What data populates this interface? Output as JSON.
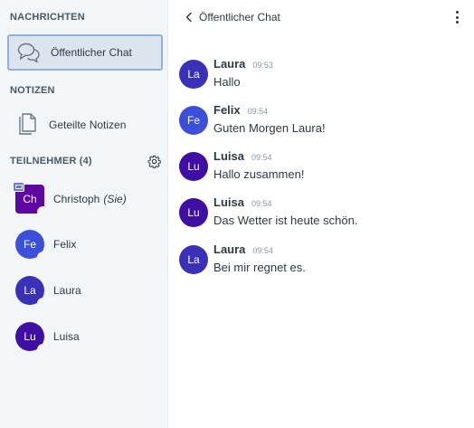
{
  "sidebar": {
    "messages_section": "NACHRICHTEN",
    "public_chat_label": "Öffentlicher Chat",
    "notes_section": "NOTIZEN",
    "shared_notes_label": "Geteilte Notizen",
    "participants_section": "TEILNEHMER (4)",
    "participants": [
      {
        "initials": "Ch",
        "name": "Christoph",
        "tag": "(Sie)",
        "color": "#5e05a2",
        "presenter": true
      },
      {
        "initials": "Fe",
        "name": "Felix",
        "color": "#3b4fd9"
      },
      {
        "initials": "La",
        "name": "Laura",
        "color": "#3a31b8"
      },
      {
        "initials": "Lu",
        "name": "Luisa",
        "color": "#3f0ea3"
      }
    ]
  },
  "chat": {
    "title": "Öffentlicher Chat",
    "messages": [
      {
        "initials": "La",
        "sender": "Laura",
        "time": "09:53",
        "text": "Hallo",
        "color": "#3a31b8"
      },
      {
        "initials": "Fe",
        "sender": "Felix",
        "time": "09:54",
        "text": "Guten Morgen Laura!",
        "color": "#3b4fd9"
      },
      {
        "initials": "Lu",
        "sender": "Luisa",
        "time": "09:54",
        "text": "Hallo zusammen!",
        "color": "#3f0ea3"
      },
      {
        "initials": "Lu",
        "sender": "Luisa",
        "time": "09:54",
        "text": "Das Wetter ist heute schön.",
        "color": "#3f0ea3"
      },
      {
        "initials": "La",
        "sender": "Laura",
        "time": "09:54",
        "text": "Bei mir regnet es.",
        "color": "#3a31b8"
      }
    ]
  },
  "icons": {
    "chat": "chat-bubbles-icon",
    "notes": "notes-icon",
    "settings": "gear-icon",
    "back": "chevron-left-icon",
    "menu": "kebab-menu-icon",
    "presenter": "presenter-icon"
  }
}
